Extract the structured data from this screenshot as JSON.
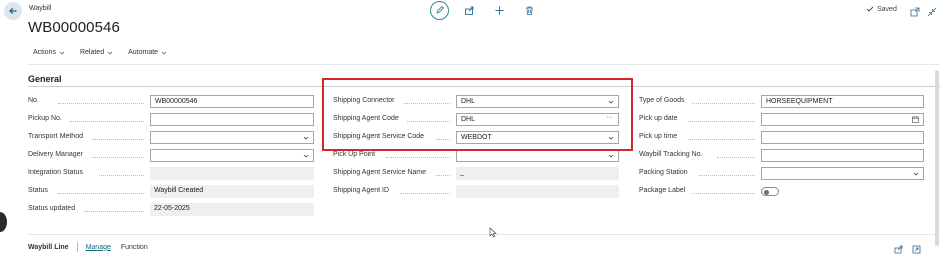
{
  "header": {
    "caption": "Waybill",
    "title": "WB00000546",
    "saved_label": "Saved"
  },
  "menu": {
    "items": [
      "Actions",
      "Related",
      "Automate"
    ]
  },
  "general": {
    "section_title": "General",
    "col1": [
      {
        "label": "No.",
        "value": "WB00000546",
        "type": "input"
      },
      {
        "label": "Pickup No.",
        "value": "",
        "type": "input"
      },
      {
        "label": "Transport Method",
        "value": "",
        "type": "select"
      },
      {
        "label": "Delivery Manager",
        "value": "",
        "type": "select"
      },
      {
        "label": "Integration Status",
        "value": "",
        "type": "readonly"
      },
      {
        "label": "Status",
        "value": "Waybill Created",
        "type": "readonly"
      },
      {
        "label": "Status updated",
        "value": "22-05-2025",
        "type": "readonly"
      }
    ],
    "col2": [
      {
        "label": "Shipping Connector",
        "value": "DHL",
        "type": "select"
      },
      {
        "label": "Shipping Agent Code",
        "value": "DHL",
        "type": "lookup"
      },
      {
        "label": "Shipping Agent Service Code",
        "value": "WEBDOT",
        "type": "select"
      },
      {
        "label": "Pick Up Point",
        "value": "",
        "type": "select"
      },
      {
        "label": "Shipping Agent Service Name",
        "value": "_",
        "type": "readonly"
      },
      {
        "label": "Shipping Agent ID",
        "value": "",
        "type": "readonly"
      }
    ],
    "col3": [
      {
        "label": "Type of Goods",
        "value": "HORSEEQUIPMENT",
        "type": "input"
      },
      {
        "label": "Pick up date",
        "value": "",
        "type": "date"
      },
      {
        "label": "Pick up time",
        "value": "",
        "type": "input"
      },
      {
        "label": "Waybill Tracking No.",
        "value": "",
        "type": "input"
      },
      {
        "label": "Packing Station",
        "value": "",
        "type": "select"
      },
      {
        "label": "Package Label",
        "value": "",
        "type": "toggle"
      }
    ]
  },
  "lines": {
    "title": "Waybill Line",
    "tabs": [
      "Manage",
      "Function"
    ]
  },
  "colors": {
    "accent": "#196b7a",
    "highlight": "#d7262a"
  }
}
